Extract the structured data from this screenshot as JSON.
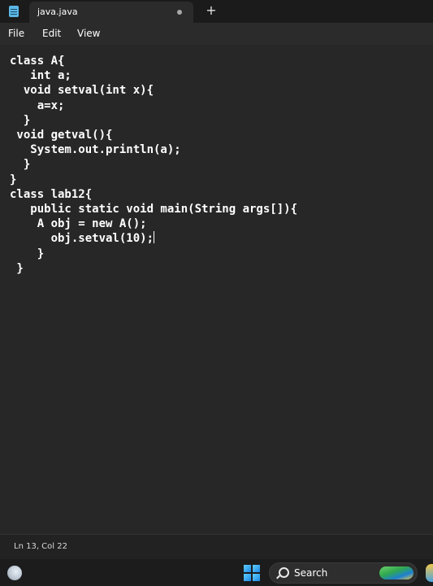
{
  "tab": {
    "title": "java.java",
    "new_tab_label": "+"
  },
  "menu": {
    "file": "File",
    "edit": "Edit",
    "view": "View"
  },
  "editor": {
    "lines": [
      "class A{",
      "   int a;",
      "  void setval(int x){",
      "    a=x;",
      "  }",
      " void getval(){",
      "   System.out.println(a);",
      "  }",
      "}",
      "class lab12{",
      "   public static void main(String args[]){",
      "    A obj = new A();",
      "      obj.setval(10);",
      "    }",
      " }"
    ],
    "caret_line": 13
  },
  "status": {
    "position": "Ln 13, Col 22"
  },
  "taskbar": {
    "search_label": "Search"
  },
  "colors": {
    "background": "#272727",
    "tabbar": "#1b1b1b",
    "text": "#ffffff"
  }
}
